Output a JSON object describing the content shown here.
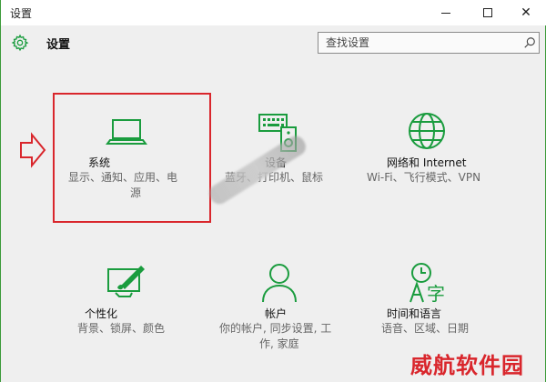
{
  "window": {
    "title": "设置",
    "minimize_label": "",
    "maximize_label": "",
    "close_label": "✕"
  },
  "header": {
    "title": "设置",
    "gear_icon": "gear-icon"
  },
  "search": {
    "placeholder": "查找设置",
    "icon": "search-icon"
  },
  "tiles": [
    {
      "name": "系统",
      "desc_line1": "显示、通知、应用、电",
      "desc_line2": "源",
      "icon": "laptop-icon"
    },
    {
      "name": "设备",
      "desc_line1": "蓝牙、打印机、鼠标",
      "desc_line2": "",
      "icon": "keyboard-speaker-icon"
    },
    {
      "name": "网络和 Internet",
      "desc_line1": "Wi-Fi、飞行模式、VPN",
      "desc_line2": "",
      "icon": "globe-icon"
    },
    {
      "name": "个性化",
      "desc_line1": "背景、锁屏、颜色",
      "desc_line2": "",
      "icon": "paint-brush-screen-icon"
    },
    {
      "name": "帐户",
      "desc_line1": "你的帐户, 同步设置, 工",
      "desc_line2": "作, 家庭",
      "icon": "person-icon"
    },
    {
      "name": "时间和语言",
      "desc_line1": "语音、区域、日期",
      "desc_line2": "",
      "icon": "clock-language-icon"
    }
  ],
  "watermark": "威航软件园",
  "colors": {
    "accent": "#1a9c3e",
    "highlight": "#d9262c",
    "border": "#3c9b3a"
  }
}
